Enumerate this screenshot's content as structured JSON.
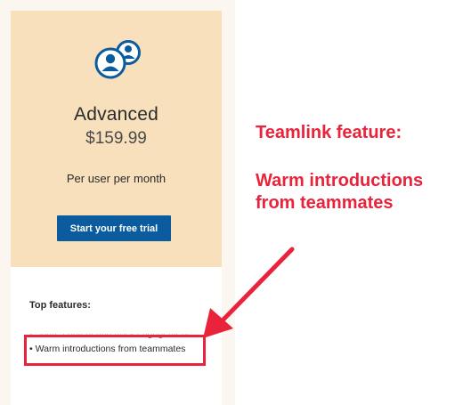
{
  "plan": {
    "icon": "users-icon",
    "name": "Advanced",
    "price": "$159.99",
    "period": "Per user per month",
    "cta_label": "Start your free trial"
  },
  "features": {
    "title": "Top features:",
    "items": [
      "• Share content and track engagement",
      "• Warm introductions from teammates"
    ]
  },
  "annotation": {
    "title": "Teamlink feature:",
    "body_line_1": "Warm introductions",
    "body_line_2": "from teammates"
  },
  "colors": {
    "card_top_bg": "#f8e0bd",
    "card_frame_bg": "#fcf6f1",
    "button_bg": "#0b5c9e",
    "icon_blue": "#0b5c9e",
    "annotation_red": "#e8233b"
  }
}
